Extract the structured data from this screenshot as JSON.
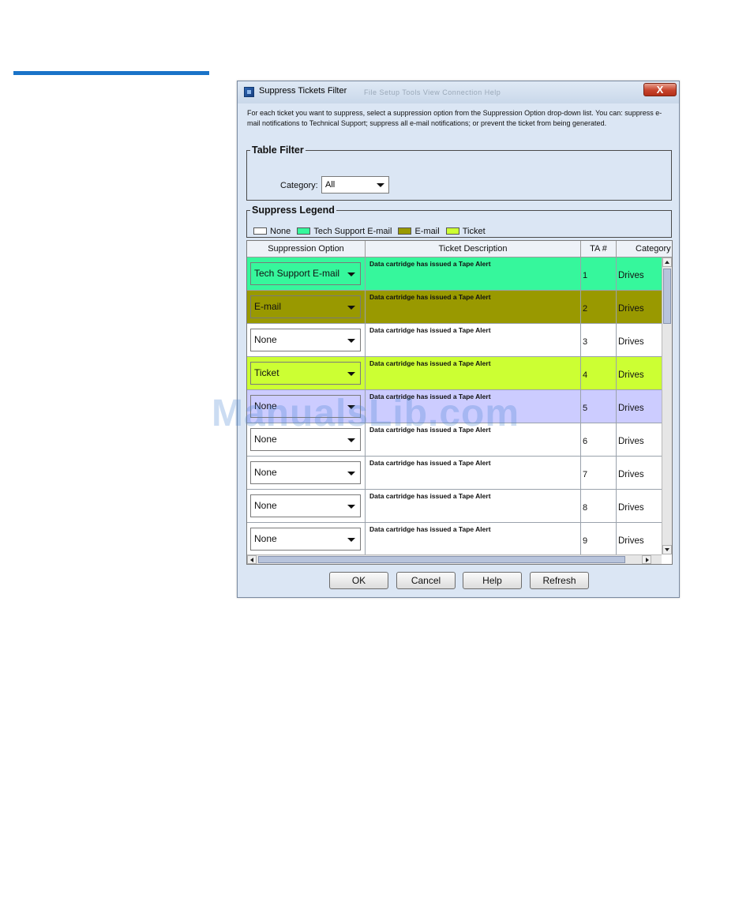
{
  "dialog": {
    "title": "Suppress Tickets Filter",
    "ghost_menu": "File   Setup   Tools   View   Connection   Help",
    "close_label": "X",
    "instructions": "For each ticket you want to suppress, select a suppression option from the Suppression Option drop-down list. You can: suppress e-mail notifications to Technical Support; suppress all e-mail notifications; or prevent the ticket from being generated."
  },
  "table_filter": {
    "title": "Table Filter",
    "category_label": "Category:",
    "category_value": "All"
  },
  "suppress_legend": {
    "title": "Suppress Legend",
    "items": [
      {
        "label": "None",
        "color": "#ffffff"
      },
      {
        "label": "Tech Support E-mail",
        "color": "#36f79c"
      },
      {
        "label": "E-mail",
        "color": "#999900"
      },
      {
        "label": "Ticket",
        "color": "#ccff33"
      }
    ]
  },
  "table": {
    "columns": [
      "Suppression Option",
      "Ticket Description",
      "TA #",
      "Category"
    ],
    "rows": [
      {
        "option": "Tech Support E-mail",
        "description": "Data cartridge has issued a Tape Alert",
        "ta": "1",
        "category": "Drives",
        "color": "#36f79c"
      },
      {
        "option": "E-mail",
        "description": "Data cartridge has issued a Tape Alert",
        "ta": "2",
        "category": "Drives",
        "color": "#999900"
      },
      {
        "option": "None",
        "description": "Data cartridge has issued a Tape Alert",
        "ta": "3",
        "category": "Drives",
        "color": "#ffffff"
      },
      {
        "option": "Ticket",
        "description": "Data cartridge has issued a Tape Alert",
        "ta": "4",
        "category": "Drives",
        "color": "#ccff33"
      },
      {
        "option": "None",
        "description": "Data cartridge has issued a Tape Alert",
        "ta": "5",
        "category": "Drives",
        "color": "#ccccff"
      },
      {
        "option": "None",
        "description": "Data cartridge has issued a Tape Alert",
        "ta": "6",
        "category": "Drives",
        "color": "#ffffff"
      },
      {
        "option": "None",
        "description": "Data cartridge has issued a Tape Alert",
        "ta": "7",
        "category": "Drives",
        "color": "#ffffff"
      },
      {
        "option": "None",
        "description": "Data cartridge has issued a Tape Alert",
        "ta": "8",
        "category": "Drives",
        "color": "#ffffff"
      },
      {
        "option": "None",
        "description": "Data cartridge has issued a Tape Alert",
        "ta": "9",
        "category": "Drives",
        "color": "#ffffff"
      }
    ]
  },
  "buttons": {
    "ok": "OK",
    "cancel": "Cancel",
    "help": "Help",
    "refresh": "Refresh"
  },
  "watermark": "ManualsLib.com",
  "colors": {
    "accent_rule": "#1a73c8",
    "dialog_bg": "#dbe6f4"
  }
}
